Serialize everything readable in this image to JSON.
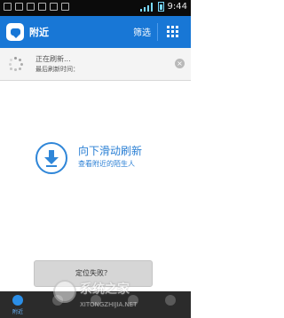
{
  "status_bar": {
    "time": "9:44",
    "icons": [
      "usb-icon",
      "debug-icon",
      "notification-icon",
      "image-icon",
      "chat-icon",
      "clock-icon"
    ]
  },
  "header": {
    "title": "附近",
    "filter_label": "筛选",
    "grid_icon": "grid-icon",
    "accent_color": "#1877d6"
  },
  "refresh_status": {
    "title": "正在刷新...",
    "last_refresh": "最后刷新时间："
  },
  "pull_prompt": {
    "title": "向下滑动刷新",
    "subtitle": "查看附近的陌生人",
    "color": "#2a7fd4"
  },
  "toast": {
    "text": "定位失败？"
  },
  "bottom_nav": {
    "tabs": [
      {
        "label": "附近",
        "active": true
      },
      {
        "label": "",
        "active": false
      },
      {
        "label": "",
        "active": false
      },
      {
        "label": "",
        "active": false
      },
      {
        "label": "",
        "active": false
      }
    ]
  },
  "watermark": {
    "text": "系统之家",
    "url": "XITONGZHIJIA.NET"
  }
}
